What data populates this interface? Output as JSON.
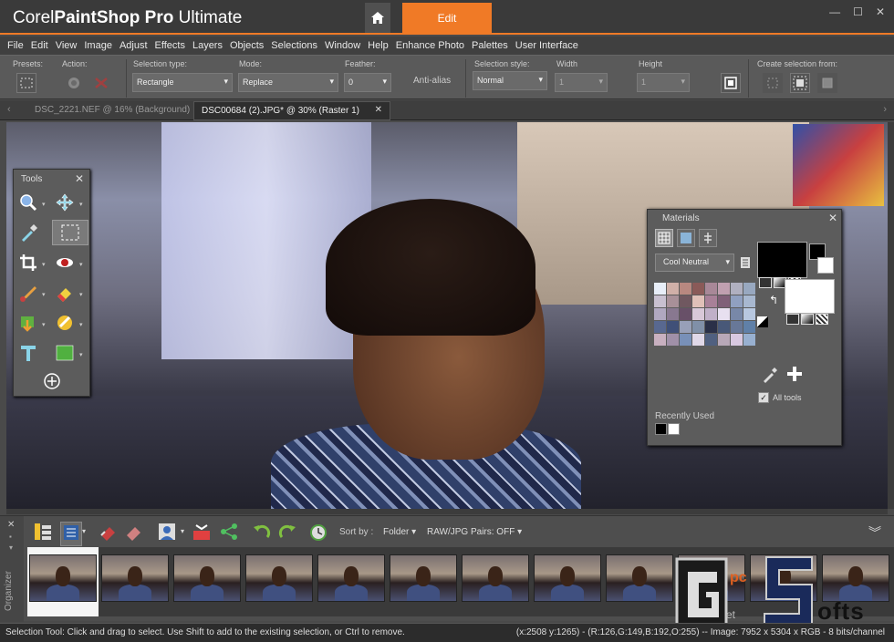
{
  "app": {
    "brand_1": "Corel",
    "brand_2": "PaintShop",
    "brand_3": "Pro",
    "brand_4": "Ultimate",
    "edit_tab": "Edit"
  },
  "menu": [
    "File",
    "Edit",
    "View",
    "Image",
    "Adjust",
    "Effects",
    "Layers",
    "Objects",
    "Selections",
    "Window",
    "Help",
    "Enhance Photo",
    "Palettes",
    "User Interface"
  ],
  "toolbar": {
    "presets_label": "Presets:",
    "action_label": "Action:",
    "selection_type_label": "Selection type:",
    "selection_type_value": "Rectangle",
    "mode_label": "Mode:",
    "mode_value": "Replace",
    "feather_label": "Feather:",
    "feather_value": "0",
    "antialias_label": "Anti-alias",
    "selection_style_label": "Selection style:",
    "selection_style_value": "Normal",
    "width_label": "Width",
    "width_value": "1",
    "height_label": "Height",
    "height_value": "1",
    "create_selection_label": "Create selection from:"
  },
  "tabs": [
    {
      "label": "DSC_2221.NEF @  16% (Background)"
    },
    {
      "label": "DSC00684 (2).JPG* @  30% (Raster 1)"
    }
  ],
  "tools_palette": {
    "title": "Tools"
  },
  "materials": {
    "title": "Materials",
    "palette_select": "Cool Neutral",
    "all_tools_label": "All tools",
    "recently_used_label": "Recently Used",
    "foreground_color": "#000000",
    "background_color": "#ffffff",
    "swatches": [
      "#e8eef8",
      "#d0b0a8",
      "#b88880",
      "#8a5a58",
      "#a88898",
      "#c0a0b0",
      "#b0b0c0",
      "#98a8c0",
      "#c8c0d0",
      "#a89098",
      "#705860",
      "#e0c0b8",
      "#a88098",
      "#806078",
      "#90a0c0",
      "#a8b8d0",
      "#b0a8c0",
      "#887890",
      "#685068",
      "#d8c8d8",
      "#c0b0c8",
      "#e8e0f0",
      "#7888a8",
      "#b8c8e0",
      "#586890",
      "#405078",
      "#98a0b8",
      "#8090a8",
      "#2a3048",
      "#485878",
      "#687898",
      "#6080a8",
      "#c8b0c0",
      "#a090a8",
      "#7890b8",
      "#e0d8e8",
      "#506080",
      "#b8a8b8",
      "#d8c8e0",
      "#98b0d0"
    ]
  },
  "organizer": {
    "label": "Organizer",
    "sort_by_label": "Sort by :",
    "sort_by_value": "Folder",
    "raw_pairs_label": "RAW/JPG Pairs: OFF",
    "thumbnail_count": 12
  },
  "status": {
    "left": "Selection Tool: Click and drag to select. Use Shift to add to the existing selection, or Ctrl to remove.",
    "right": "(x:2508 y:1265) - (R:126,G:149,B:192,O:255) -- Image:  7952 x 5304 x RGB - 8 bits/channel"
  },
  "watermark": {
    "text_1": "pc",
    "text_2": "et",
    "text_3": "ofts"
  },
  "colors": {
    "accent": "#f07a26"
  }
}
